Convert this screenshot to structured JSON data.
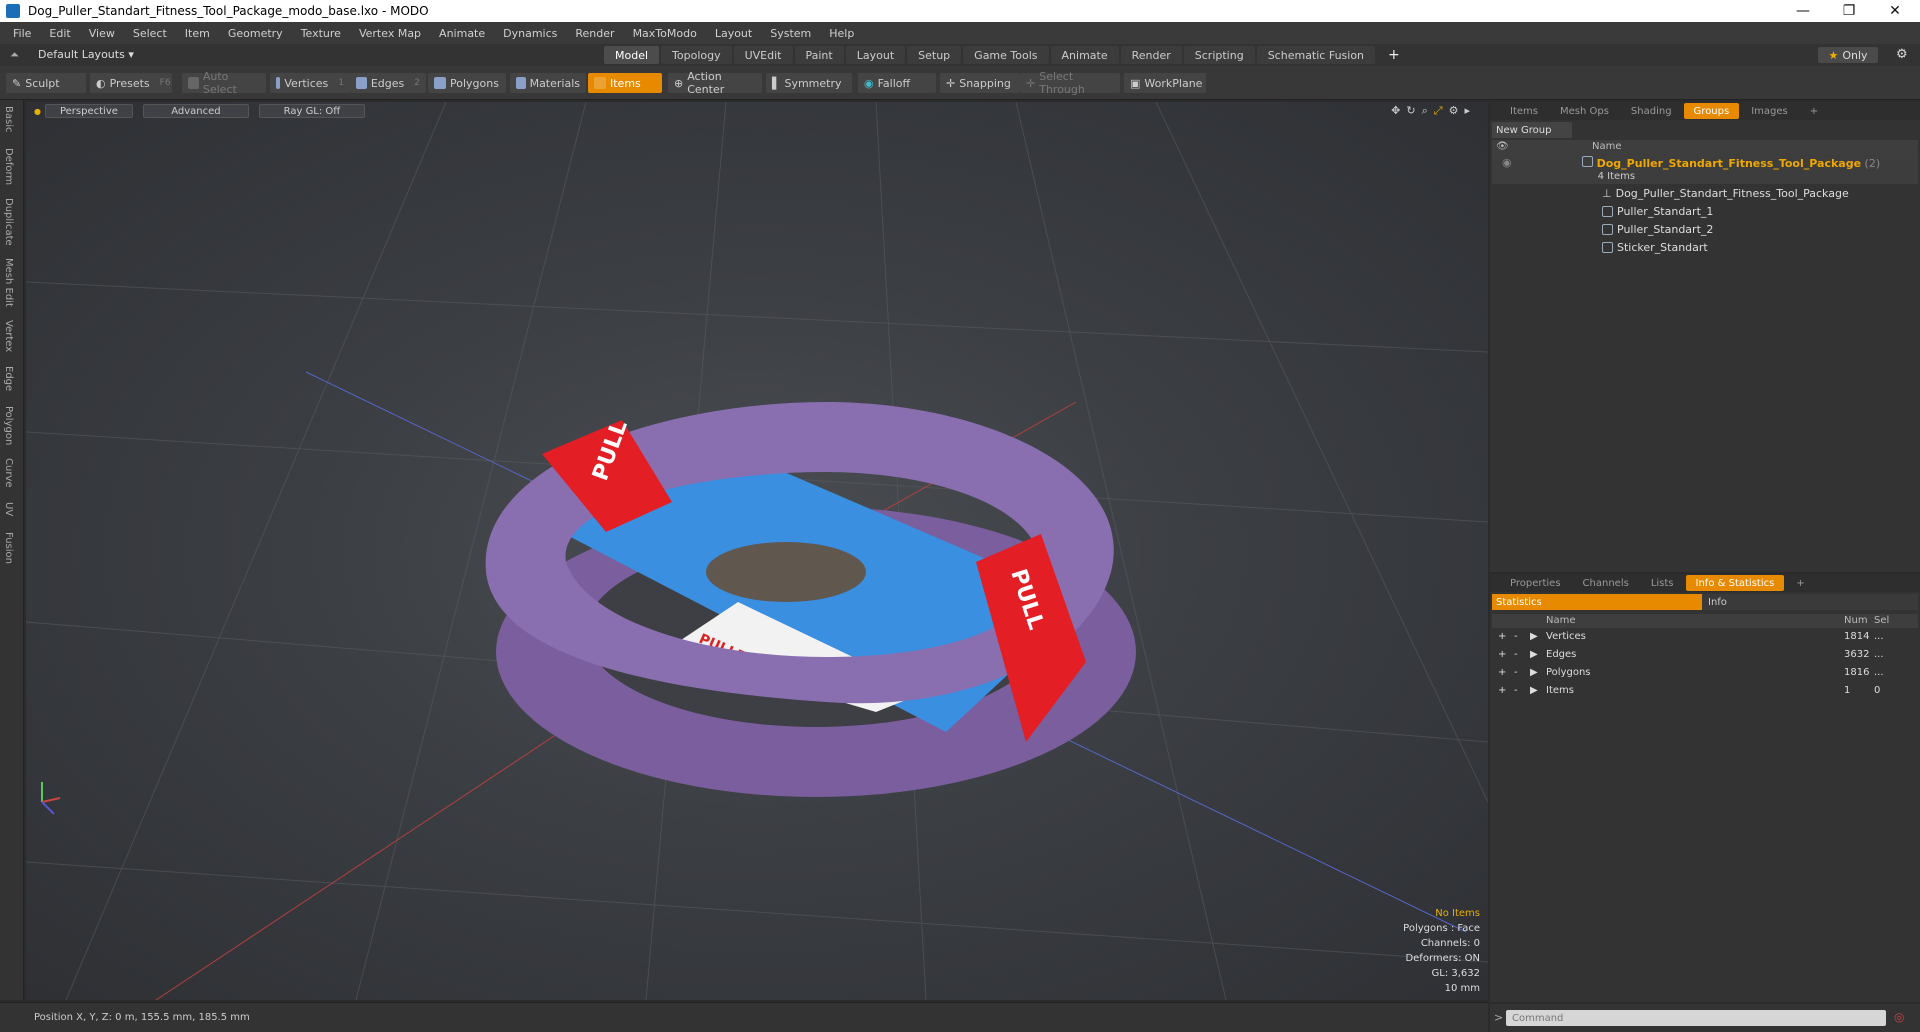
{
  "window": {
    "title": "Dog_Puller_Standart_Fitness_Tool_Package_modo_base.lxo - MODO"
  },
  "menu": [
    "File",
    "Edit",
    "View",
    "Select",
    "Item",
    "Geometry",
    "Texture",
    "Vertex Map",
    "Animate",
    "Dynamics",
    "Render",
    "MaxToModo",
    "Layout",
    "System",
    "Help"
  ],
  "layout": {
    "selector": "Default Layouts",
    "tabs": [
      "Model",
      "Topology",
      "UVEdit",
      "Paint",
      "Layout",
      "Setup",
      "Game Tools",
      "Animate",
      "Render",
      "Scripting",
      "Schematic Fusion"
    ],
    "active_tab": "Model",
    "only_label": "Only"
  },
  "toolbar": {
    "sculpt": "Sculpt",
    "presets": "Presets",
    "presets_key": "F6",
    "auto_select": "Auto Select",
    "vertices": "Vertices",
    "vertices_key": "1",
    "edges": "Edges",
    "edges_key": "2",
    "polygons": "Polygons",
    "materials": "Materials",
    "items": "Items",
    "action_center": "Action Center",
    "symmetry": "Symmetry",
    "falloff": "Falloff",
    "snapping": "Snapping",
    "select_through": "Select Through",
    "workplane": "WorkPlane"
  },
  "left_tabs": [
    "Basic",
    "Deform",
    "Duplicate",
    "Mesh Edit",
    "Vertex",
    "Edge",
    "Polygon",
    "Curve",
    "UV",
    "Fusion"
  ],
  "viewport": {
    "view": "Perspective",
    "shading": "Advanced",
    "raygl": "Ray GL: Off",
    "info": {
      "no_items": "No Items",
      "polygons": "Polygons : Face",
      "channels": "Channels: 0",
      "deformers": "Deformers: ON",
      "gl": "GL: 3,632",
      "scale": "10 mm"
    },
    "model": {
      "sticker_text": "PULLER STANDARD",
      "band_text": "PULL"
    }
  },
  "status": {
    "position": "Position X, Y, Z:  0 m, 155.5 mm, 185.5 mm"
  },
  "groups_panel": {
    "tabs": [
      "Items",
      "Mesh Ops",
      "Shading",
      "Groups",
      "Images"
    ],
    "active_tab": "Groups",
    "new_group": "New Group",
    "col_name": "Name",
    "group_name": "Dog_Puller_Standart_Fitness_Tool_Package",
    "group_count": "(2)",
    "group_items": "4 Items",
    "children": [
      "Dog_Puller_Standart_Fitness_Tool_Package",
      "Puller_Standart_1",
      "Puller_Standart_2",
      "Sticker_Standart"
    ]
  },
  "stats_panel": {
    "tabs": [
      "Properties",
      "Channels",
      "Lists",
      "Info & Statistics"
    ],
    "active_tab": "Info & Statistics",
    "statistics": "Statistics",
    "info": "Info",
    "col_name": "Name",
    "col_num": "Num",
    "col_sel": "Sel",
    "rows": [
      {
        "name": "Vertices",
        "num": "1814",
        "sel": "..."
      },
      {
        "name": "Edges",
        "num": "3632",
        "sel": "..."
      },
      {
        "name": "Polygons",
        "num": "1816",
        "sel": "..."
      },
      {
        "name": "Items",
        "num": "1",
        "sel": "0"
      }
    ]
  },
  "command": {
    "placeholder": "Command"
  },
  "colors": {
    "accent": "#e88a00",
    "toy": "#8a6fb0",
    "band": "#e31e24",
    "sticker": "#3a8fe0"
  }
}
